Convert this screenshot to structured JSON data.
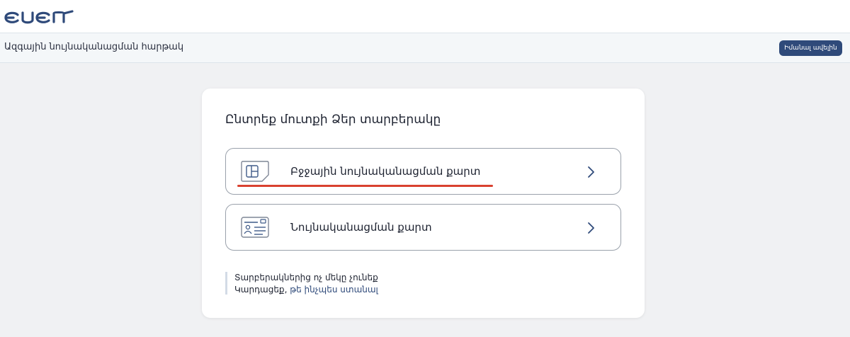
{
  "header": {
    "logo_text": "ԵԱԵՄ"
  },
  "subheader": {
    "service_title": "Ազգային նույնականացման հարթակ",
    "learn_more_label": "Իմանալ ավելին"
  },
  "login_card": {
    "title": "Ընտրեք մուտքի Ձեր տարբերակը",
    "options": [
      {
        "label": "Բջջային նույնականացման քարտ",
        "icon": "sim-card-icon"
      },
      {
        "label": "Նույնականացման քարտ",
        "icon": "id-card-icon"
      }
    ],
    "help": {
      "line1": "Տարբերակներից ոչ մեկը չունեք",
      "line2_prefix": "Կարդացեք,",
      "line2_link": "թե ինչպես ստանալ"
    }
  },
  "colors": {
    "brand": "#2f4a7a",
    "highlight_underline": "#d9412f",
    "page_background": "#f0f1f3"
  }
}
